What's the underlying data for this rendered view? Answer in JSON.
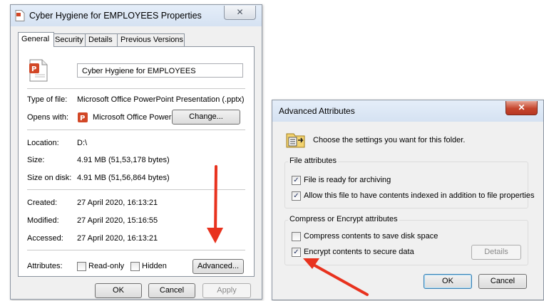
{
  "properties": {
    "title": "Cyber  Hygiene  for  EMPLOYEES Properties",
    "close_label": "✕",
    "tabs": [
      "General",
      "Security",
      "Details",
      "Previous Versions"
    ],
    "file_name": "Cyber  Hygiene  for  EMPLOYEES",
    "rows": {
      "type_label": "Type of file:",
      "type_value": "Microsoft Office PowerPoint Presentation (.pptx)",
      "opens_label": "Opens with:",
      "opens_value": "Microsoft Office PowerF",
      "change_button": "Change...",
      "location_label": "Location:",
      "location_value": "D:\\",
      "size_label": "Size:",
      "size_value": "4.91 MB (51,53,178 bytes)",
      "disk_label": "Size on disk:",
      "disk_value": "4.91 MB (51,56,864 bytes)",
      "created_label": "Created:",
      "created_value": "27 April 2020, 16:13:21",
      "modified_label": "Modified:",
      "modified_value": "27 April 2020, 15:16:55",
      "accessed_label": "Accessed:",
      "accessed_value": "27 April 2020, 16:13:21",
      "attributes_label": "Attributes:",
      "readonly_label": "Read-only",
      "hidden_label": "Hidden",
      "advanced_button": "Advanced..."
    },
    "footer": {
      "ok": "OK",
      "cancel": "Cancel",
      "apply": "Apply"
    }
  },
  "advanced": {
    "title": "Advanced Attributes",
    "close_label": "✕",
    "intro": "Choose the settings you want for this folder.",
    "file_attributes_label": "File attributes",
    "archive_label": "File is ready for archiving",
    "index_label": "Allow this file to have contents indexed in addition to file properties",
    "compress_group_label": "Compress or Encrypt attributes",
    "compress_label": "Compress contents to save disk space",
    "encrypt_label": "Encrypt contents to secure data",
    "details_button": "Details",
    "ok": "OK",
    "cancel": "Cancel",
    "checked_mark": "✓",
    "checkboxes": {
      "archive": true,
      "index": true,
      "compress": false,
      "encrypt": true
    }
  },
  "colors": {
    "annotation_arrow": "#e8321e"
  }
}
